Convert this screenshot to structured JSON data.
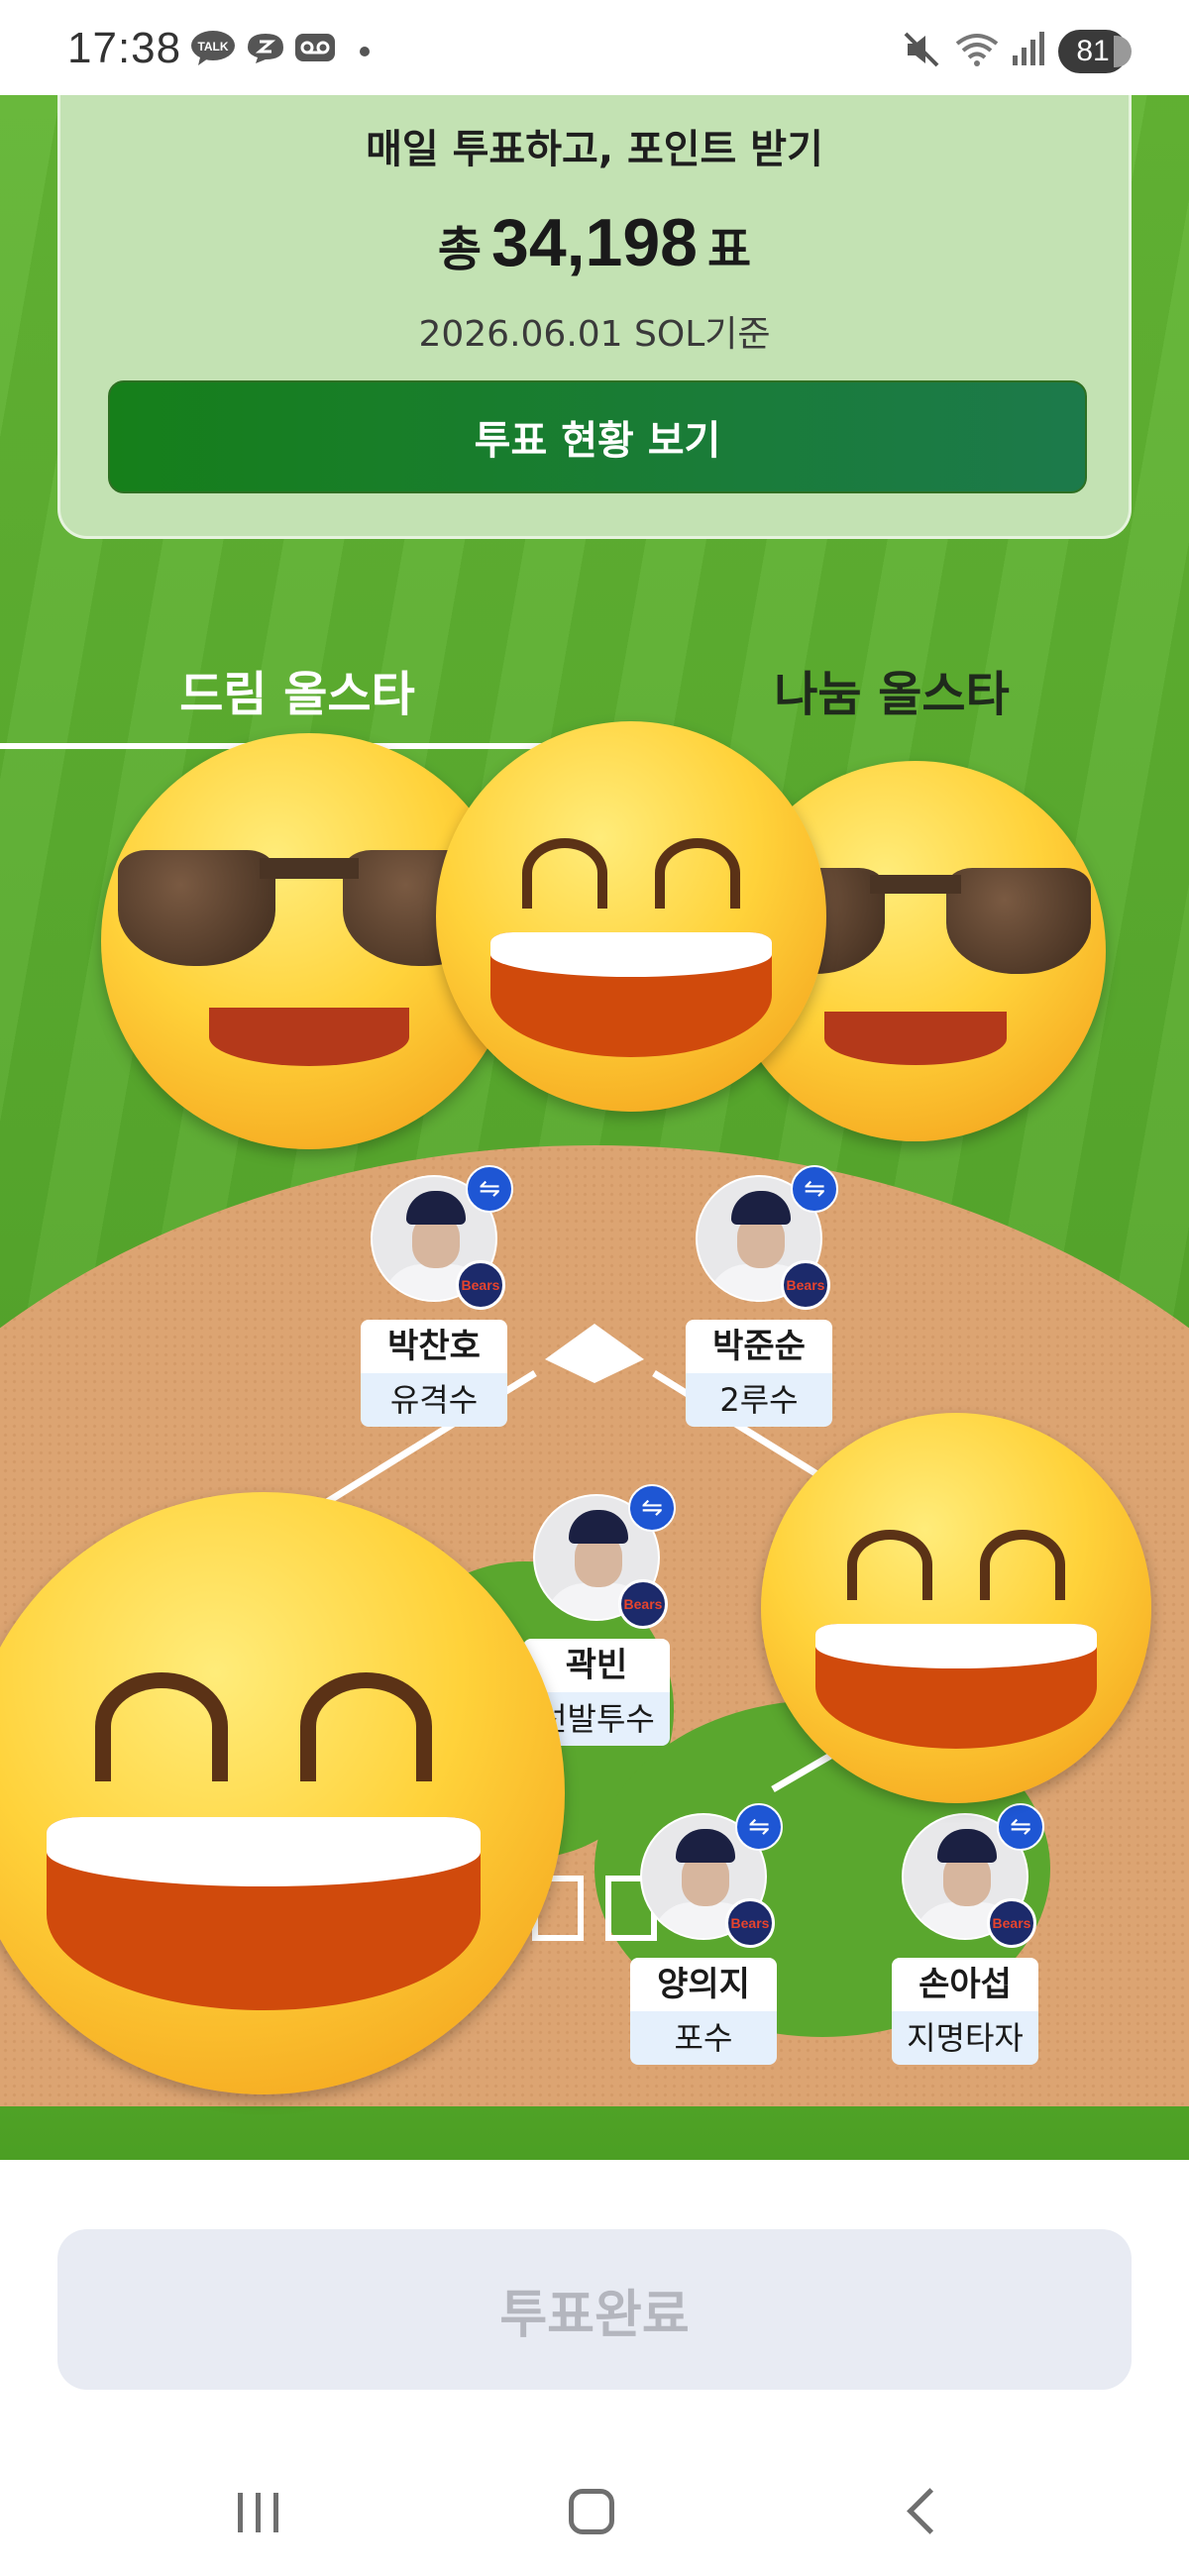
{
  "status_bar": {
    "time": "17:38",
    "battery": "81",
    "notification_icons": [
      "talk-icon",
      "chat-bubble-icon",
      "voicemail-icon",
      "dot-icon"
    ],
    "system_icons": [
      "mute-icon",
      "wifi-icon",
      "signal-icon",
      "battery-icon"
    ]
  },
  "vote_card": {
    "headline": "매일 투표하고, 포인트 받기",
    "total_prefix": "총",
    "total_votes": "34,198",
    "total_suffix": "표",
    "as_of": "2026.06.01 SOL기준",
    "status_button": "투표 현황 보기"
  },
  "tabs": [
    {
      "label": "드림 올스타",
      "active": true
    },
    {
      "label": "나눔 올스타",
      "active": false
    }
  ],
  "players": [
    {
      "name": "박찬호",
      "position": "유격수"
    },
    {
      "name": "박준순",
      "position": "2루수"
    },
    {
      "name": "곽빈",
      "position": "선발투수"
    },
    {
      "name": "양의지",
      "position": "포수"
    },
    {
      "name": "손아섭",
      "position": "지명타자"
    }
  ],
  "team_logo_text": "Bears",
  "swap_icon": "⇋",
  "complete_button": "투표완료",
  "colors": {
    "field_green": "#57a82c",
    "card_bg": "#c3e2b3",
    "button_green": "#167f1a",
    "swap_blue": "#1e56d4",
    "dirt": "#dca472",
    "disabled_button": "#e8ebf3"
  },
  "overlays": [
    "sunglasses-emoji",
    "grinning-emoji",
    "sunglasses-emoji",
    "grinning-emoji",
    "grinning-emoji"
  ]
}
